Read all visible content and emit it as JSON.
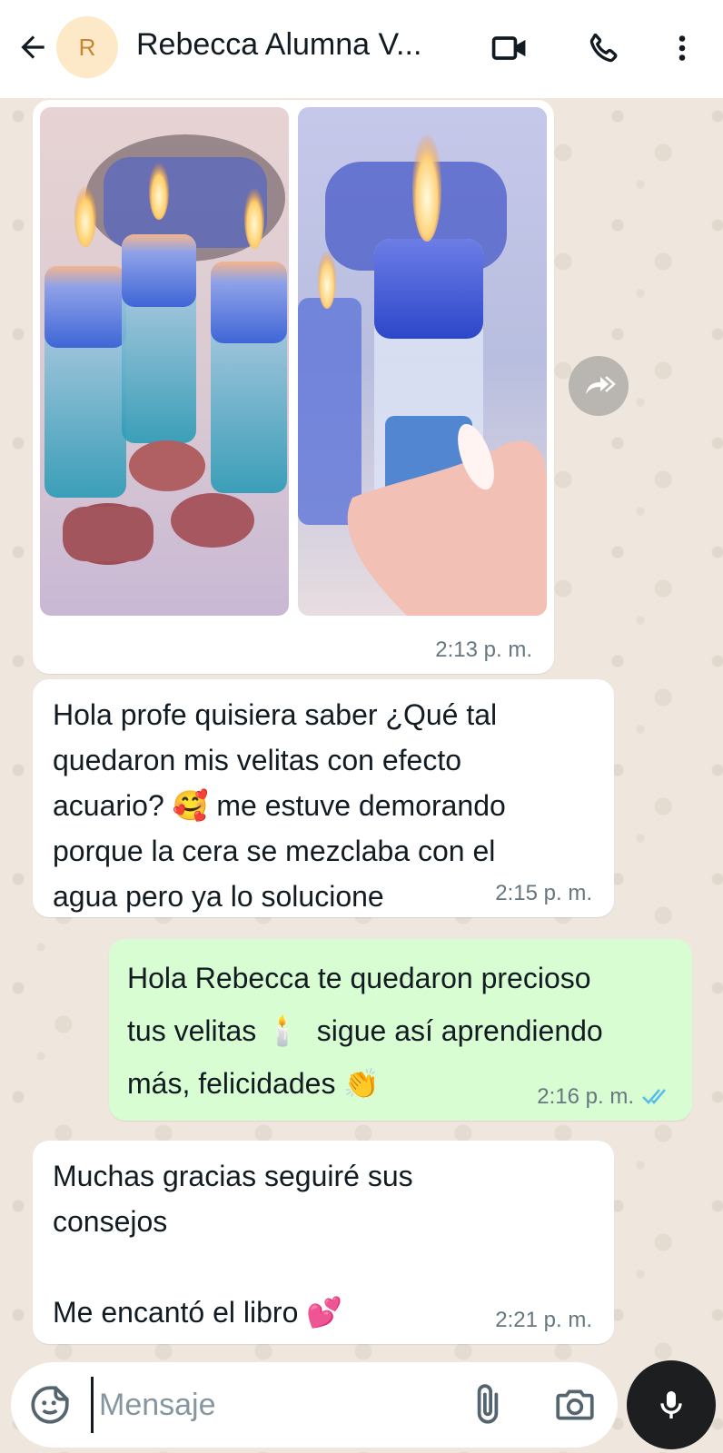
{
  "header": {
    "avatar_initial": "R",
    "contact_name": "Rebecca Alumna V...",
    "icons": [
      "back-arrow-icon",
      "video-call-icon",
      "phone-icon",
      "more-vert-icon"
    ]
  },
  "messages": [
    {
      "type": "images",
      "direction": "in",
      "time": "2:13 p. m."
    },
    {
      "type": "text",
      "direction": "in",
      "lines": [
        "Hola profe quisiera saber ¿Qué tal",
        "quedaron mis velitas con efecto",
        "acuario? 🥰 me estuve demorando",
        "porque la cera se mezclaba con el",
        "agua pero ya lo solucione"
      ],
      "time": "2:15 p. m."
    },
    {
      "type": "text",
      "direction": "out",
      "lines": [
        "Hola Rebecca te quedaron precioso",
        "tus velitas 🕯️  sigue así aprendiendo",
        "más, felicidades 👏"
      ],
      "time": "2:16 p. m.",
      "status": "read"
    },
    {
      "type": "text",
      "direction": "in",
      "lines": [
        "Muchas gracias seguiré sus",
        "consejos",
        "",
        "Me encantó el libro 💕"
      ],
      "time": "2:21 p. m."
    }
  ],
  "composer": {
    "placeholder": "Mensaje"
  },
  "colors": {
    "outgoing_bubble": "#d9fdd3",
    "read_ticks": "#53bdeb",
    "avatar_bg": "#fde9c8"
  }
}
